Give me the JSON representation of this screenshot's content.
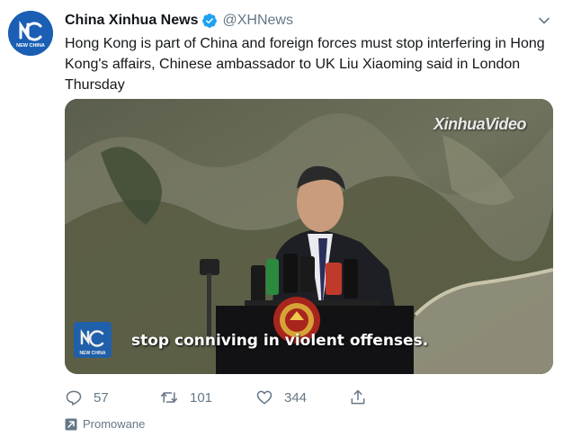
{
  "tweet": {
    "author_name": "China Xinhua News",
    "author_handle": "@XHNews",
    "avatar_text": "NEW CHINA",
    "text": "Hong Kong is part of China and foreign forces must stop interfering in Hong Kong's affairs, Chinese ambassador to UK Liu Xiaoming said in London Thursday",
    "media": {
      "watermark": "XinhuaVideo",
      "subtitle": "stop conniving in violent offenses.",
      "logo_text": "NEW CHINA"
    },
    "actions": {
      "replies": "57",
      "retweets": "101",
      "likes": "344"
    },
    "promoted_label": "Promowane"
  },
  "colors": {
    "accent": "#1da1f2",
    "secondary_text": "#657786",
    "brand_blue": "#1a5fb4"
  },
  "icons": {
    "verified": "verified-badge-icon",
    "caret": "chevron-down-icon",
    "reply": "reply-icon",
    "retweet": "retweet-icon",
    "like": "heart-icon",
    "share": "share-icon",
    "promoted": "promoted-arrow-icon"
  }
}
